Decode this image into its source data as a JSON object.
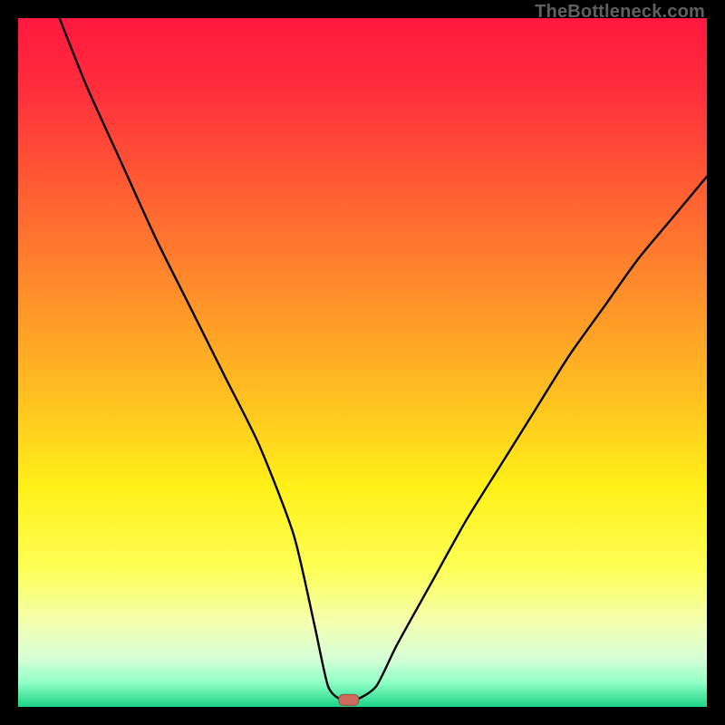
{
  "watermark": "TheBottleneck.com",
  "chart_data": {
    "type": "line",
    "title": "",
    "xlabel": "",
    "ylabel": "",
    "xlim": [
      0,
      100
    ],
    "ylim": [
      0,
      100
    ],
    "grid": false,
    "series": [
      {
        "name": "bottleneck-curve",
        "x": [
          6,
          10,
          15,
          20,
          25,
          30,
          35,
          40,
          43,
          45,
          47,
          49,
          52,
          55,
          60,
          65,
          70,
          75,
          80,
          85,
          90,
          95,
          100
        ],
        "y": [
          100,
          90,
          79,
          68,
          58,
          48,
          38,
          25,
          12,
          3,
          1,
          1,
          3,
          9,
          18,
          27,
          35,
          43,
          51,
          58,
          65,
          71,
          77
        ]
      }
    ],
    "markers": [
      {
        "name": "optimal-point",
        "x": 48,
        "y": 1,
        "color": "#c96a5b"
      }
    ],
    "background_gradient": {
      "stops": [
        {
          "offset": 0.0,
          "color": "#ff183f"
        },
        {
          "offset": 0.1,
          "color": "#ff2d3c"
        },
        {
          "offset": 0.25,
          "color": "#ff5e33"
        },
        {
          "offset": 0.4,
          "color": "#ff8f2a"
        },
        {
          "offset": 0.55,
          "color": "#ffc021"
        },
        {
          "offset": 0.68,
          "color": "#fff018"
        },
        {
          "offset": 0.8,
          "color": "#fdff56"
        },
        {
          "offset": 0.88,
          "color": "#f3ffb3"
        },
        {
          "offset": 0.93,
          "color": "#d6ffd6"
        },
        {
          "offset": 0.965,
          "color": "#8fffc5"
        },
        {
          "offset": 1.0,
          "color": "#1bd486"
        }
      ]
    }
  }
}
